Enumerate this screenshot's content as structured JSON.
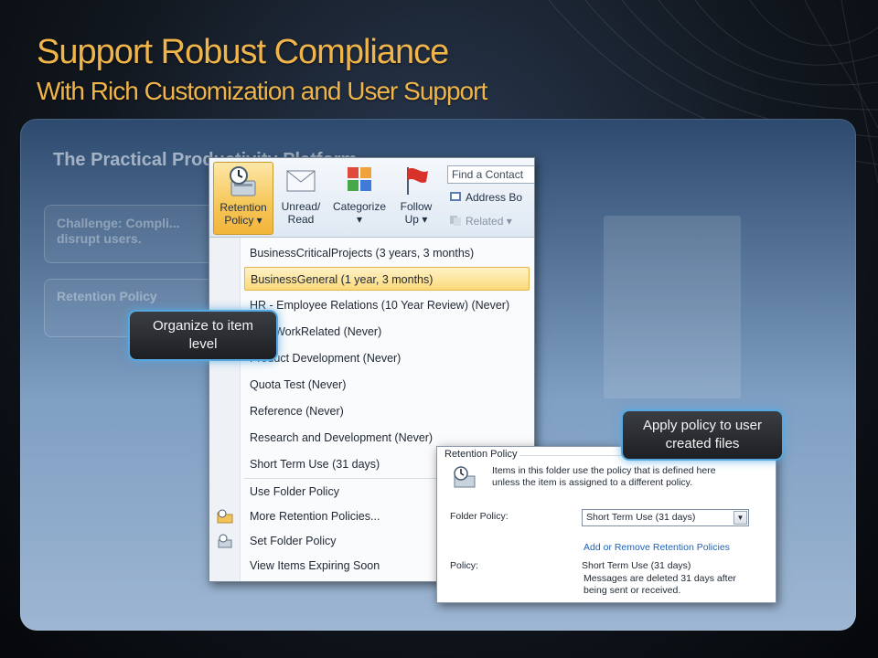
{
  "slide": {
    "title_line1": "Support Robust Compliance",
    "title_line2": "With Rich Customization and User Support",
    "subtitle": "The Practical Productivity Platform",
    "ghost_box1": "Challenge: Compli... disrupt users.",
    "ghost_box2": "Retention Policy",
    "accent_color": "#f0b54a"
  },
  "outlook": {
    "ribbon": {
      "retention_policy_label": "Retention\nPolicy ▾",
      "unread_read_label": "Unread/\nRead",
      "categorize_label": "Categorize\n▾",
      "follow_up_label": "Follow\nUp ▾",
      "find_contact_placeholder": "Find a Contact",
      "address_book_label": "Address Bo",
      "related_label": "Related ▾"
    },
    "menu_items": [
      "BusinessCriticalProjects (3 years, 3 months)",
      "BusinessGeneral (1 year, 3 months)",
      "HR - Employee Relations (10 Year Review) (Never)",
      "Non-WorkRelated (Never)",
      "Product Development (Never)",
      "Quota Test (Never)",
      "Reference (Never)",
      "Research and Development (Never)",
      "Short Term Use (31 days)"
    ],
    "menu_actions": [
      "Use Folder Policy",
      "More Retention Policies...",
      "Set Folder Policy",
      "View Items Expiring Soon"
    ]
  },
  "dialog": {
    "group_title": "Retention Policy",
    "description": "Items in this folder use the policy that is defined here unless the item is assigned to a different policy.",
    "folder_policy_label": "Folder Policy:",
    "folder_policy_value": "Short Term Use (31 days)",
    "add_remove_link": "Add or Remove Retention Policies",
    "policy_label": "Policy:",
    "policy_value": "Short Term Use (31 days)",
    "policy_detail": "Messages are deleted 31 days after being sent or received."
  },
  "callouts": {
    "organize": "Organize to item level",
    "apply": "Apply policy to user created files"
  }
}
